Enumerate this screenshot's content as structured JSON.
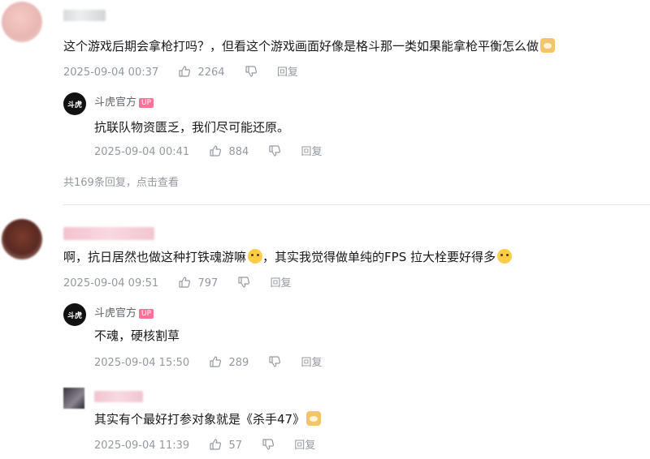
{
  "comments": [
    {
      "text": "这个游戏后期会拿枪打吗？，但看这个游戏画面好像是格斗那一类如果能拿枪平衡怎么做",
      "time": "2025-09-04 00:37",
      "likes": "2264",
      "reply_label": "回复",
      "replies": [
        {
          "author": "斗虎官方",
          "badge": "UP",
          "text": "抗联队物资匮乏，我们尽可能还原。",
          "time": "2025-09-04 00:41",
          "likes": "884",
          "reply_label": "回复"
        }
      ],
      "more_replies": "共169条回复，点击查看"
    },
    {
      "text": "啊，抗日居然也做这种打铁魂游嘛",
      "text_2": "，其实我觉得做单纯的FPS 拉大栓要好得多",
      "time": "2025-09-04 09:51",
      "likes": "797",
      "reply_label": "回复",
      "replies": [
        {
          "author": "斗虎官方",
          "badge": "UP",
          "text": "不魂，硬核割草",
          "time": "2025-09-04 15:50",
          "likes": "289",
          "reply_label": "回复"
        },
        {
          "text": "其实有个最好打参对象就是《杀手47》",
          "time": "2025-09-04 11:39",
          "likes": "57",
          "reply_label": "回复"
        }
      ]
    }
  ],
  "sub_avatar_glyph": "斗虎",
  "colors": {
    "badge": "#fb7299",
    "meta": "#9499a0",
    "text": "#18191c"
  }
}
